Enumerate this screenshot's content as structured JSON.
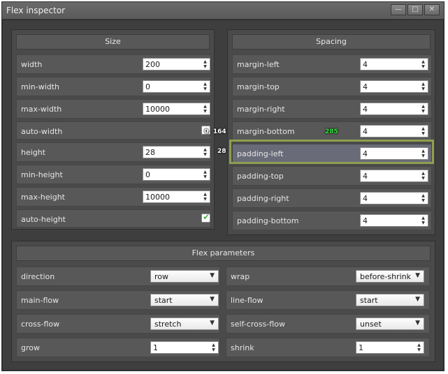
{
  "window": {
    "title": "Flex inspector",
    "buttons": {
      "minimize": "—",
      "maximize": "□",
      "close": "✕"
    }
  },
  "size_panel": {
    "header": "Size",
    "rows": [
      {
        "label": "width",
        "value": "200"
      },
      {
        "label": "min-width",
        "value": "0"
      },
      {
        "label": "max-width",
        "value": "10000"
      },
      {
        "label": "auto-width",
        "checked": false
      },
      {
        "label": "height",
        "value": "28"
      },
      {
        "label": "min-height",
        "value": "0"
      },
      {
        "label": "max-height",
        "value": "10000"
      },
      {
        "label": "auto-height",
        "checked": true
      }
    ]
  },
  "spacing_panel": {
    "header": "Spacing",
    "rows": [
      {
        "label": "margin-left",
        "value": "4"
      },
      {
        "label": "margin-top",
        "value": "4"
      },
      {
        "label": "margin-right",
        "value": "4"
      },
      {
        "label": "margin-bottom",
        "value": "4"
      },
      {
        "label": "padding-left",
        "value": "4"
      },
      {
        "label": "padding-top",
        "value": "4"
      },
      {
        "label": "padding-right",
        "value": "4"
      },
      {
        "label": "padding-bottom",
        "value": "4"
      }
    ]
  },
  "flex_panel": {
    "header": "Flex parameters",
    "rows": [
      {
        "left_label": "direction",
        "left_value": "row",
        "right_label": "wrap",
        "right_value": "before-shrink"
      },
      {
        "left_label": "main-flow",
        "left_value": "start",
        "right_label": "line-flow",
        "right_value": "start"
      },
      {
        "left_label": "cross-flow",
        "left_value": "stretch",
        "right_label": "self-cross-flow",
        "right_value": "unset"
      },
      {
        "left_label": "grow",
        "left_value": "1",
        "right_label": "shrink",
        "right_value": "1"
      }
    ]
  },
  "overlays": {
    "coords": "0, 164",
    "height_readout": "28",
    "width_readout": "285"
  },
  "colors": {
    "highlight": "#8ea04f",
    "overlay_green": "#37e23a",
    "check": "#4bb043"
  }
}
